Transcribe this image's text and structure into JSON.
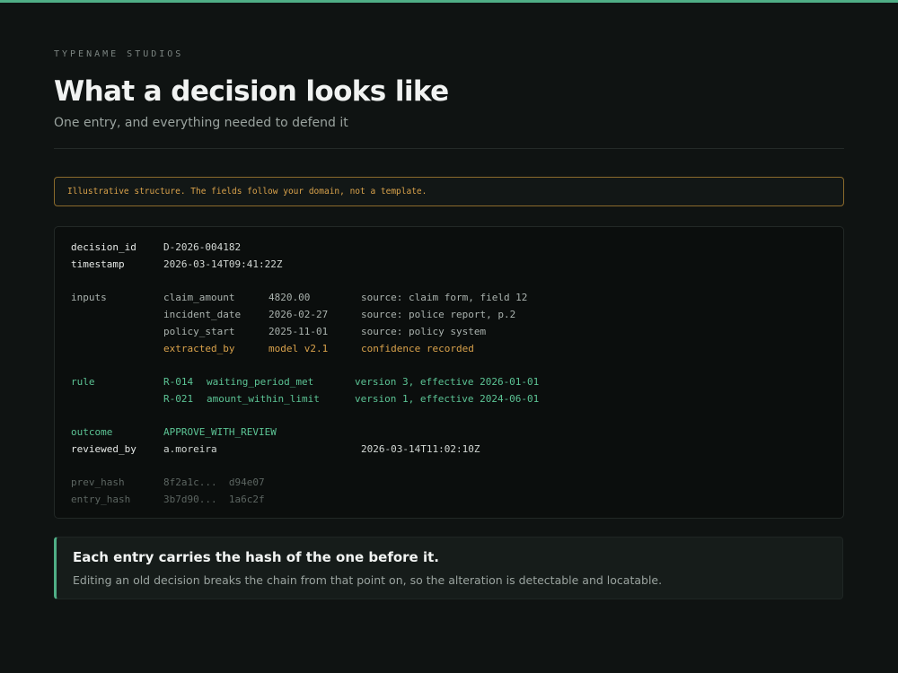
{
  "brand": "TYPENAME STUDIOS",
  "title": "What a decision looks like",
  "subtitle": "One entry, and everything needed to defend it",
  "notice": "Illustrative structure. The fields follow your domain, not a template.",
  "record": {
    "decision_id": {
      "key": "decision_id",
      "value": "D-2026-004182"
    },
    "timestamp": {
      "key": "timestamp",
      "value": "2026-03-14T09:41:22Z"
    },
    "inputs": {
      "key": "inputs",
      "rows": [
        {
          "name": "claim_amount",
          "value": "4820.00",
          "source": "source: claim form, field 12"
        },
        {
          "name": "incident_date",
          "value": "2026-02-27",
          "source": "source: police report, p.2"
        },
        {
          "name": "policy_start",
          "value": "2025-11-01",
          "source": "source: policy system"
        },
        {
          "name": "extracted_by",
          "value": "model v2.1",
          "source": "confidence recorded"
        }
      ]
    },
    "rule": {
      "key": "rule",
      "rows": [
        {
          "id": "R-014",
          "name": "waiting_period_met",
          "version": "version 3, effective 2026-01-01"
        },
        {
          "id": "R-021",
          "name": "amount_within_limit",
          "version": "version 1, effective 2024-06-01"
        }
      ]
    },
    "outcome": {
      "key": "outcome",
      "value": "APPROVE_WITH_REVIEW"
    },
    "reviewed_by": {
      "key": "reviewed_by",
      "value": "a.moreira",
      "time": "2026-03-14T11:02:10Z"
    },
    "prev_hash": {
      "key": "prev_hash",
      "value": "8f2a1c...  d94e07"
    },
    "entry_hash": {
      "key": "entry_hash",
      "value": "3b7d90...  1a6c2f"
    }
  },
  "callout": {
    "title": "Each entry carries the hash of the one before it.",
    "body": "Editing an old decision breaks the chain from that point on, so the alteration is detectable and locatable."
  },
  "colors": {
    "accent": "#4fae86",
    "amber": "#d9a24b",
    "background": "#0f1312"
  }
}
